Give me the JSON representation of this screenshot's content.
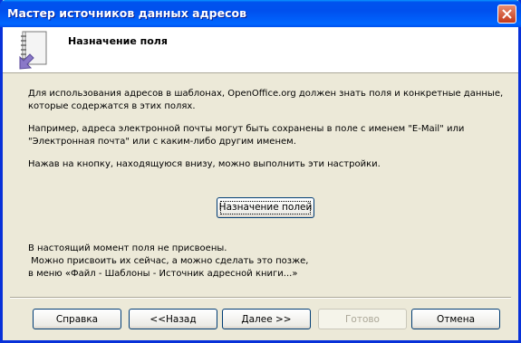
{
  "window": {
    "title": "Мастер источников данных адресов"
  },
  "header": {
    "title": "Назначение поля"
  },
  "body": {
    "para1": [
      "Для использования адресов в шаблонах, OpenOffice.org должен знать поля и конкретные данные,",
      "которые содержатся в этих полях."
    ],
    "para2": [
      "Например, адреса электронной почты могут быть сохранены в поле с именем \"E-Mail\" или",
      "\"Электронная почта\" или с каким-либо другим именем."
    ],
    "para3": [
      "Нажав на кнопку, находящуюся внизу, можно выполнить эти настройки."
    ],
    "assign_button": "Назначение полей",
    "status": [
      "В настоящий момент поля не присвоены.",
      " Можно присвоить их сейчас, а можно сделать это позже,",
      "в меню «Файл - Шаблоны - Источник адресной книги...»"
    ]
  },
  "buttons": {
    "help": "Справка",
    "back": "<<Назад",
    "next": "Далее >>",
    "finish": "Готово",
    "cancel": "Отмена"
  }
}
